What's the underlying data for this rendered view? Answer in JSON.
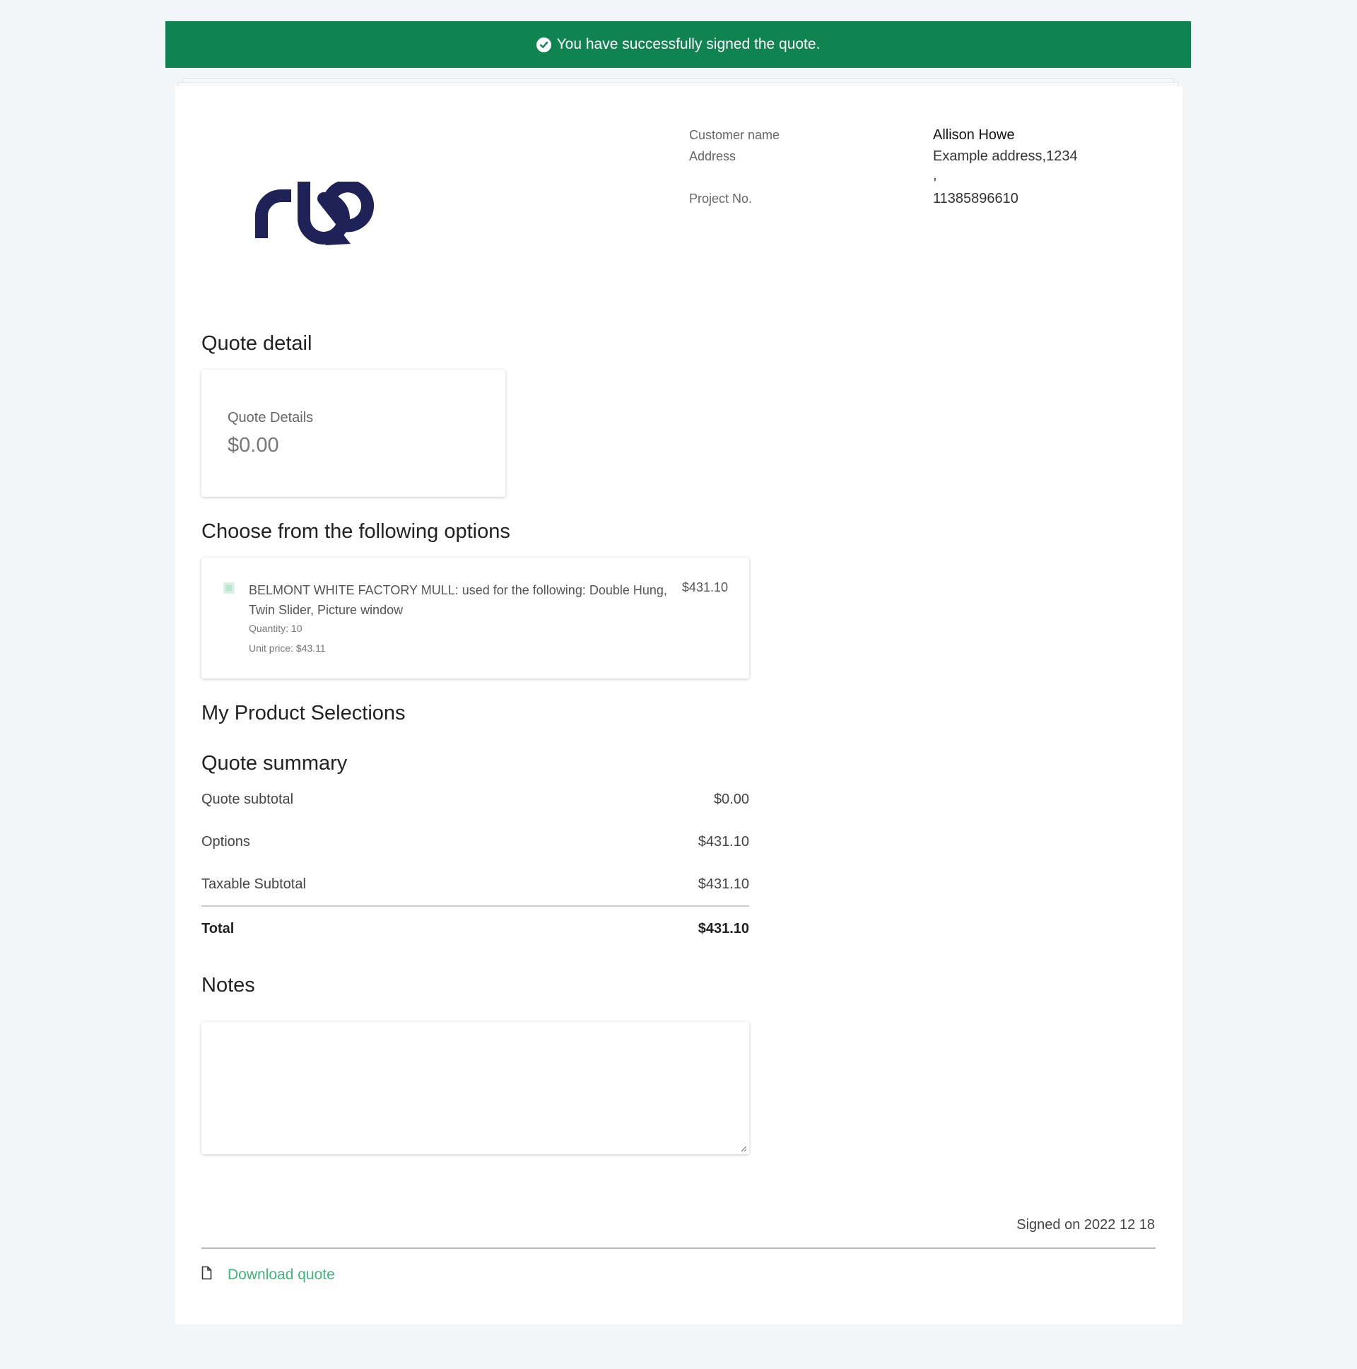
{
  "banner": {
    "message": "You have successfully signed the quote.",
    "icon": "check-circle-icon",
    "color": "#0f8451"
  },
  "logo": {
    "text": "rbp",
    "color": "#1f2257"
  },
  "customer": {
    "name_label": "Customer name",
    "name": "Allison Howe",
    "address_label": "Address",
    "address_line1": "Example address,1234",
    "address_line2": ",",
    "project_label": "Project No.",
    "project_no": "11385896610"
  },
  "quote_detail": {
    "heading": "Quote detail",
    "card_label": "Quote Details",
    "card_value": "$0.00"
  },
  "options": {
    "heading": "Choose from the following options",
    "items": [
      {
        "title": "BELMONT WHITE FACTORY MULL: used for the following: Double Hung, Twin Slider, Picture window",
        "price": "$431.10",
        "quantity": "Quantity: 10",
        "unit_price": "Unit price: $43.11",
        "checked": true
      }
    ]
  },
  "product_selections": {
    "heading": "My Product Selections"
  },
  "summary": {
    "heading": "Quote summary",
    "rows": [
      {
        "label": "Quote subtotal",
        "value": "$0.00"
      },
      {
        "label": "Options",
        "value": "$431.10"
      },
      {
        "label": "Taxable Subtotal",
        "value": "$431.10"
      }
    ],
    "total_label": "Total",
    "total_value": "$431.10"
  },
  "notes": {
    "heading": "Notes",
    "value": ""
  },
  "footer": {
    "signed": "Signed on 2022 12 18",
    "download_label": "Download quote",
    "download_icon": "file-icon",
    "link_color": "#3cb878"
  }
}
